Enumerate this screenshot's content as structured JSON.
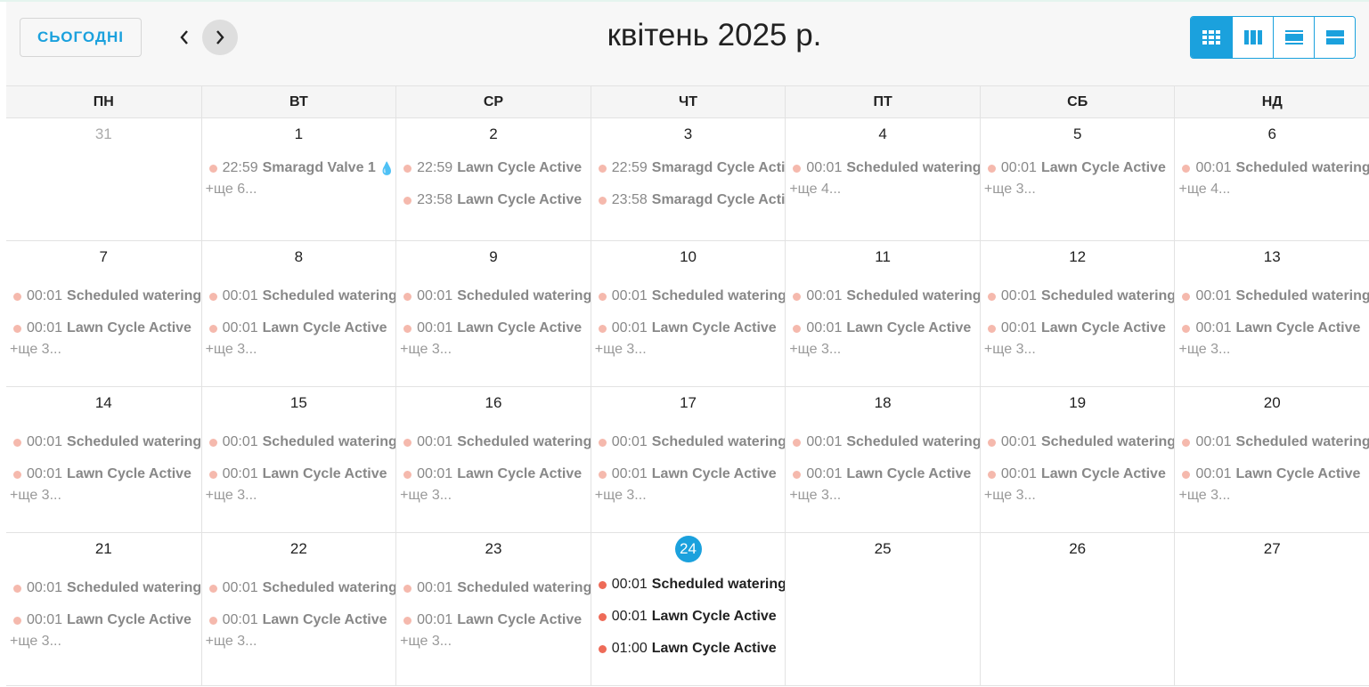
{
  "toolbar": {
    "today_label": "СЬОГОДНІ",
    "title": "квітень 2025 р.",
    "views": [
      "month-icon",
      "week-icon",
      "day-icon",
      "list-icon"
    ]
  },
  "weekdays": [
    "ПН",
    "ВТ",
    "СР",
    "ЧТ",
    "ПТ",
    "СБ",
    "НД"
  ],
  "weeks": [
    {
      "days": [
        {
          "num": "31",
          "other": true,
          "events": [],
          "more": ""
        },
        {
          "num": "1",
          "events": [
            {
              "time": "22:59",
              "title": "Smaragd Valve 1",
              "icon": "water-drop-icon"
            }
          ],
          "more": "+ще 6..."
        },
        {
          "num": "2",
          "events": [
            {
              "time": "22:59",
              "title": "Lawn Cycle Active"
            },
            {
              "time": "23:58",
              "title": "Lawn Cycle Active"
            }
          ],
          "more": ""
        },
        {
          "num": "3",
          "events": [
            {
              "time": "22:59",
              "title": "Smaragd Cycle Active"
            },
            {
              "time": "23:58",
              "title": "Smaragd Cycle Active"
            }
          ],
          "more": ""
        },
        {
          "num": "4",
          "events": [
            {
              "time": "00:01",
              "title": "Scheduled watering"
            }
          ],
          "more": "+ще 4..."
        },
        {
          "num": "5",
          "events": [
            {
              "time": "00:01",
              "title": "Lawn Cycle Active"
            }
          ],
          "more": "+ще 3..."
        },
        {
          "num": "6",
          "events": [
            {
              "time": "00:01",
              "title": "Scheduled watering"
            }
          ],
          "more": "+ще 4..."
        }
      ]
    },
    {
      "days": [
        {
          "num": "7",
          "events": [
            {
              "time": "00:01",
              "title": "Scheduled watering"
            },
            {
              "time": "00:01",
              "title": "Lawn Cycle Active"
            }
          ],
          "more": "+ще 3..."
        },
        {
          "num": "8",
          "events": [
            {
              "time": "00:01",
              "title": "Scheduled watering"
            },
            {
              "time": "00:01",
              "title": "Lawn Cycle Active"
            }
          ],
          "more": "+ще 3..."
        },
        {
          "num": "9",
          "events": [
            {
              "time": "00:01",
              "title": "Scheduled watering"
            },
            {
              "time": "00:01",
              "title": "Lawn Cycle Active"
            }
          ],
          "more": "+ще 3..."
        },
        {
          "num": "10",
          "events": [
            {
              "time": "00:01",
              "title": "Scheduled watering"
            },
            {
              "time": "00:01",
              "title": "Lawn Cycle Active"
            }
          ],
          "more": "+ще 3..."
        },
        {
          "num": "11",
          "events": [
            {
              "time": "00:01",
              "title": "Scheduled watering"
            },
            {
              "time": "00:01",
              "title": "Lawn Cycle Active"
            }
          ],
          "more": "+ще 3..."
        },
        {
          "num": "12",
          "events": [
            {
              "time": "00:01",
              "title": "Scheduled watering"
            },
            {
              "time": "00:01",
              "title": "Lawn Cycle Active"
            }
          ],
          "more": "+ще 3..."
        },
        {
          "num": "13",
          "events": [
            {
              "time": "00:01",
              "title": "Scheduled watering"
            },
            {
              "time": "00:01",
              "title": "Lawn Cycle Active"
            }
          ],
          "more": "+ще 3..."
        }
      ]
    },
    {
      "days": [
        {
          "num": "14",
          "events": [
            {
              "time": "00:01",
              "title": "Scheduled watering"
            },
            {
              "time": "00:01",
              "title": "Lawn Cycle Active"
            }
          ],
          "more": "+ще 3..."
        },
        {
          "num": "15",
          "events": [
            {
              "time": "00:01",
              "title": "Scheduled watering"
            },
            {
              "time": "00:01",
              "title": "Lawn Cycle Active"
            }
          ],
          "more": "+ще 3..."
        },
        {
          "num": "16",
          "events": [
            {
              "time": "00:01",
              "title": "Scheduled watering"
            },
            {
              "time": "00:01",
              "title": "Lawn Cycle Active"
            }
          ],
          "more": "+ще 3..."
        },
        {
          "num": "17",
          "events": [
            {
              "time": "00:01",
              "title": "Scheduled watering"
            },
            {
              "time": "00:01",
              "title": "Lawn Cycle Active"
            }
          ],
          "more": "+ще 3..."
        },
        {
          "num": "18",
          "events": [
            {
              "time": "00:01",
              "title": "Scheduled watering"
            },
            {
              "time": "00:01",
              "title": "Lawn Cycle Active"
            }
          ],
          "more": "+ще 3..."
        },
        {
          "num": "19",
          "events": [
            {
              "time": "00:01",
              "title": "Scheduled watering"
            },
            {
              "time": "00:01",
              "title": "Lawn Cycle Active"
            }
          ],
          "more": "+ще 3..."
        },
        {
          "num": "20",
          "events": [
            {
              "time": "00:01",
              "title": "Scheduled watering"
            },
            {
              "time": "00:01",
              "title": "Lawn Cycle Active"
            }
          ],
          "more": "+ще 3..."
        }
      ]
    },
    {
      "days": [
        {
          "num": "21",
          "events": [
            {
              "time": "00:01",
              "title": "Scheduled watering"
            },
            {
              "time": "00:01",
              "title": "Lawn Cycle Active"
            }
          ],
          "more": "+ще 3..."
        },
        {
          "num": "22",
          "events": [
            {
              "time": "00:01",
              "title": "Scheduled watering"
            },
            {
              "time": "00:01",
              "title": "Lawn Cycle Active"
            }
          ],
          "more": "+ще 3..."
        },
        {
          "num": "23",
          "events": [
            {
              "time": "00:01",
              "title": "Scheduled watering"
            },
            {
              "time": "00:01",
              "title": "Lawn Cycle Active"
            }
          ],
          "more": "+ще 3..."
        },
        {
          "num": "24",
          "today": true,
          "events": [
            {
              "time": "00:01",
              "title": "Scheduled watering"
            },
            {
              "time": "00:01",
              "title": "Lawn Cycle Active"
            },
            {
              "time": "01:00",
              "title": "Lawn Cycle Active"
            }
          ],
          "more": ""
        },
        {
          "num": "25",
          "events": [],
          "more": ""
        },
        {
          "num": "26",
          "events": [],
          "more": ""
        },
        {
          "num": "27",
          "events": [],
          "more": ""
        }
      ]
    }
  ],
  "colors": {
    "accent": "#1ba1dd",
    "event_past": "#f5b9ad",
    "event_today": "#ee6b58"
  }
}
